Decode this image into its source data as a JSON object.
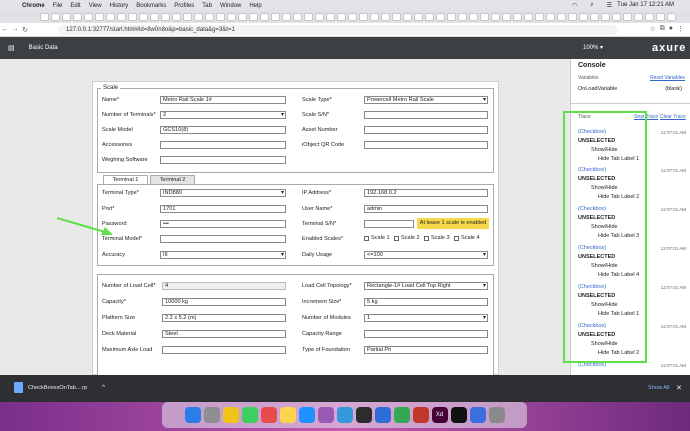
{
  "menubar": {
    "app": "Chrome",
    "items": [
      "File",
      "Edit",
      "View",
      "History",
      "Bookmarks",
      "Profiles",
      "Tab",
      "Window",
      "Help"
    ],
    "clock": "Tue Jan 17  12:21 AM"
  },
  "browser": {
    "url": "127.0.0.1:32777/start.html#id=8w0n8o&p=basic_data&g=3&t=1"
  },
  "axure": {
    "page_name": "Basic Data",
    "zoom": "100%",
    "logo": "axure"
  },
  "form": {
    "scale": {
      "legend": "Scale",
      "name_label": "Name*",
      "name_value": "Metro Rail Scale 1#",
      "scale_type_label": "Scale Type*",
      "scale_type_value": "Powercell Metro Rail Scale",
      "terminals_label": "Number of Terminals*",
      "terminals_value": "2",
      "scale_sn_label": "Scale S/N*",
      "scale_model_label": "Scale Model",
      "scale_model_value": "GCS10(8)",
      "asset_label": "Asset Number",
      "accessories_label": "Accessories",
      "qr_label": "iObject QR Code",
      "weighing_label": "Weghing Software"
    },
    "tabs": [
      "Terminal 1",
      "Terminal 2"
    ],
    "terminal": {
      "type_label": "Terminal Type*",
      "type_value": "IND880",
      "ip_label": "IP Address*",
      "ip_value": "192.168.0.2",
      "port_label": "Port*",
      "port_value": "1701",
      "user_label": "User Name*",
      "user_value": "admin",
      "password_label": "Password",
      "password_value": "•••",
      "sn_label": "Terminal S/N*",
      "model_label": "Terminal Model*",
      "enabled_label": "Enabled Scales*",
      "scales": [
        "Scale 1",
        "Scale 2",
        "Scale 3",
        "Scale 4"
      ],
      "note": "At lease 1 scale is enabled",
      "accuracy_label": "Accuracy",
      "accuracy_value": "III",
      "daily_label": "Daily Usage",
      "daily_value": "<=100"
    },
    "loadcell": {
      "count_label": "Number of Load Cell*",
      "count_value": "4",
      "topology_label": "Load Cell Topology*",
      "topology_value": "Rectangle-1# Load Cell Top Right",
      "capacity_label": "Capacity*",
      "capacity_value": "10000 kg",
      "increment_label": "Increment Size*",
      "increment_value": "5 kg",
      "platform_label": "Platform Size",
      "platform_value": "2.2 x 5.2 (m)",
      "modules_label": "Number of Modules",
      "modules_value": "1",
      "deck_label": "Deck Material",
      "deck_value": "Steel",
      "cap_range_label": "Capacity Range",
      "axle_label": "Maximum Axle Load",
      "foundation_label": "Type of Foundation",
      "foundation_value": "Partial Pit"
    }
  },
  "console": {
    "title": "Console",
    "variables_label": "Variables",
    "reset_label": "Reset Variables",
    "var_name": "OnLoadVariable",
    "var_value": "(blank)",
    "trace_label": "Trace",
    "stop_label": "Stop Trace",
    "clear_label": "Clear Trace",
    "entries": [
      {
        "source": "(Checkbox)",
        "event": "UNSELECTED",
        "action": "Show/Hide",
        "target": "Hide Tab Label 1",
        "time": "12:07:01 AM"
      },
      {
        "source": "(Checkbox)",
        "event": "UNSELECTED",
        "action": "Show/Hide",
        "target": "Hide Tab Label 2",
        "time": "12:07:01 AM"
      },
      {
        "source": "(Checkbox)",
        "event": "UNSELECTED",
        "action": "Show/Hide",
        "target": "Hide Tab Label 3",
        "time": "12:07:01 AM"
      },
      {
        "source": "(Checkbox)",
        "event": "UNSELECTED",
        "action": "Show/Hide",
        "target": "Hide Tab Label 4",
        "time": "12:07:01 AM"
      },
      {
        "source": "(Checkbox)",
        "event": "UNSELECTED",
        "action": "Show/Hide",
        "target": "Hide Tab Label 1",
        "time": "12:07:01 AM"
      },
      {
        "source": "(Checkbox)",
        "event": "UNSELECTED",
        "action": "Show/Hide",
        "target": "Hide Tab Label 2",
        "time": "12:07:01 AM"
      },
      {
        "source": "(Checkbox)",
        "event": "",
        "action": "",
        "target": "",
        "time": "12:07:01 AM"
      }
    ]
  },
  "download": {
    "file": "CheckBoxesOnTab....rp",
    "show_all": "Show All"
  },
  "colors": {
    "highlight": "#5fe04a",
    "note": "#f5d94b",
    "axure_bar": "#3c4043"
  }
}
